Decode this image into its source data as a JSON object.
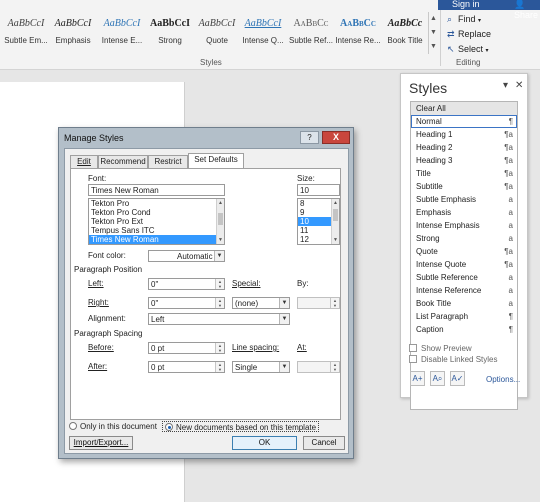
{
  "ribbon": {
    "gallery": [
      {
        "sample": "AaBbCcI",
        "name": "Subtle Em..."
      },
      {
        "sample": "AaBbCcI",
        "name": "Emphasis"
      },
      {
        "sample": "AaBbCcI",
        "name": "Intense E..."
      },
      {
        "sample": "AaBbCcI",
        "name": "Strong"
      },
      {
        "sample": "AaBbCcI",
        "name": "Quote"
      },
      {
        "sample": "AaBbCcI",
        "name": "Intense Q..."
      },
      {
        "sample": "AaBbCc",
        "name": "Subtle Ref..."
      },
      {
        "sample": "AaBbCc",
        "name": "Intense Re..."
      },
      {
        "sample": "AaBbCc",
        "name": "Book Title"
      }
    ],
    "styles_group_label": "Styles",
    "editing_group_label": "Editing",
    "sign_in": "Sign in",
    "share": "Share",
    "find": "Find",
    "replace": "Replace",
    "select": "Select"
  },
  "styles_pane": {
    "title": "Styles",
    "items": [
      {
        "name": "Clear All",
        "mark": ""
      },
      {
        "name": "Normal",
        "mark": "¶"
      },
      {
        "name": "Heading 1",
        "mark": "¶a"
      },
      {
        "name": "Heading 2",
        "mark": "¶a"
      },
      {
        "name": "Heading 3",
        "mark": "¶a"
      },
      {
        "name": "Title",
        "mark": "¶a"
      },
      {
        "name": "Subtitle",
        "mark": "¶a"
      },
      {
        "name": "Subtle Emphasis",
        "mark": "a"
      },
      {
        "name": "Emphasis",
        "mark": "a"
      },
      {
        "name": "Intense Emphasis",
        "mark": "a"
      },
      {
        "name": "Strong",
        "mark": "a"
      },
      {
        "name": "Quote",
        "mark": "¶a"
      },
      {
        "name": "Intense Quote",
        "mark": "¶a"
      },
      {
        "name": "Subtle Reference",
        "mark": "a"
      },
      {
        "name": "Intense Reference",
        "mark": "a"
      },
      {
        "name": "Book Title",
        "mark": "a"
      },
      {
        "name": "List Paragraph",
        "mark": "¶"
      },
      {
        "name": "Caption",
        "mark": "¶"
      }
    ],
    "show_preview": "Show Preview",
    "disable_linked": "Disable Linked Styles",
    "options": "Options..."
  },
  "dialog": {
    "title": "Manage Styles",
    "help": "?",
    "close": "X",
    "tabs": [
      "Edit",
      "Recommend",
      "Restrict",
      "Set Defaults"
    ],
    "font_label": "Font:",
    "font_value": "Times New Roman",
    "font_list": [
      "Tekton Pro",
      "Tekton Pro Cond",
      "Tekton Pro Ext",
      "Tempus Sans ITC",
      "Times New Roman"
    ],
    "size_label": "Size:",
    "size_value": "10",
    "size_list": [
      "8",
      "9",
      "10",
      "11",
      "12"
    ],
    "font_color_label": "Font color:",
    "font_color_value": "Automatic",
    "paragraph_position": "Paragraph Position",
    "left_label": "Left:",
    "left_value": "0\"",
    "right_label": "Right:",
    "right_value": "0\"",
    "special_label": "Special:",
    "special_value": "(none)",
    "by_label": "By:",
    "alignment_label": "Alignment:",
    "alignment_value": "Left",
    "paragraph_spacing": "Paragraph Spacing",
    "before_label": "Before:",
    "before_value": "0 pt",
    "after_label": "After:",
    "after_value": "0 pt",
    "line_spacing_label": "Line spacing:",
    "line_spacing_value": "Single",
    "at_label": "At:",
    "only_doc": "Only in this document",
    "new_docs": "New documents based on this template",
    "import_export": "Import/Export...",
    "ok": "OK",
    "cancel": "Cancel"
  }
}
